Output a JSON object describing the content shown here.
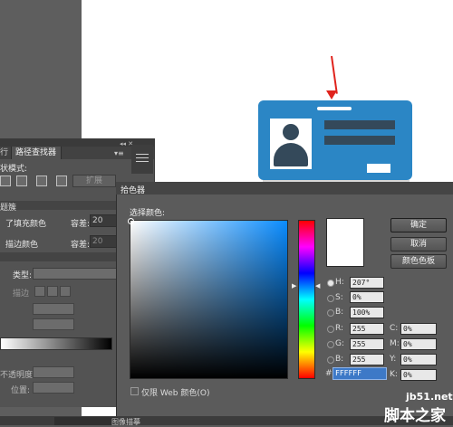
{
  "panel": {
    "tab_fragment": "行",
    "tab_pathfinder": "路径查找器",
    "menu_glyph": "▾≡",
    "collapse_glyph": "◂◂ ✕",
    "shape_mode_label": "状模式:",
    "expand_label": "扩展",
    "stroke_header": "题簇",
    "fill_label": "了填充颜色",
    "tolerance_label": "容差:",
    "tolerance_fill_value": "20",
    "stroke_color_label": "描边颜色",
    "tolerance_stroke_value": "20",
    "type_label": "类型:",
    "stroke_label": "描边",
    "opacity_label": "不透明度:",
    "position_label": "位置:"
  },
  "dialog": {
    "title": "拾色器",
    "select_color_label": "选择颜色:",
    "buttons": {
      "ok": "确定",
      "cancel": "取消",
      "swatches": "颜色色板"
    },
    "fields": {
      "H": {
        "label": "H:",
        "value": "207°"
      },
      "S": {
        "label": "S:",
        "value": "0%"
      },
      "B": {
        "label": "B:",
        "value": "100%"
      },
      "R": {
        "label": "R:",
        "value": "255"
      },
      "G": {
        "label": "G:",
        "value": "255"
      },
      "Bv": {
        "label": "B:",
        "value": "255"
      },
      "C": {
        "label": "C:",
        "value": "0%"
      },
      "M": {
        "label": "M:",
        "value": "0%"
      },
      "Y": {
        "label": "Y:",
        "value": "0%"
      },
      "K": {
        "label": "K:",
        "value": "0%"
      }
    },
    "hex_label": "#",
    "hex_value": "FFFFFF",
    "web_only_label": "仅限 Web 颜色(O)",
    "current_color": "#ffffff"
  },
  "status": {
    "text": "图像描摹"
  },
  "watermark": {
    "line1": "jb51.net",
    "line2": "脚本之家"
  },
  "colors": {
    "card_blue": "#2b86c5",
    "card_dark": "#34495a",
    "arrow_red": "#e0231c"
  }
}
